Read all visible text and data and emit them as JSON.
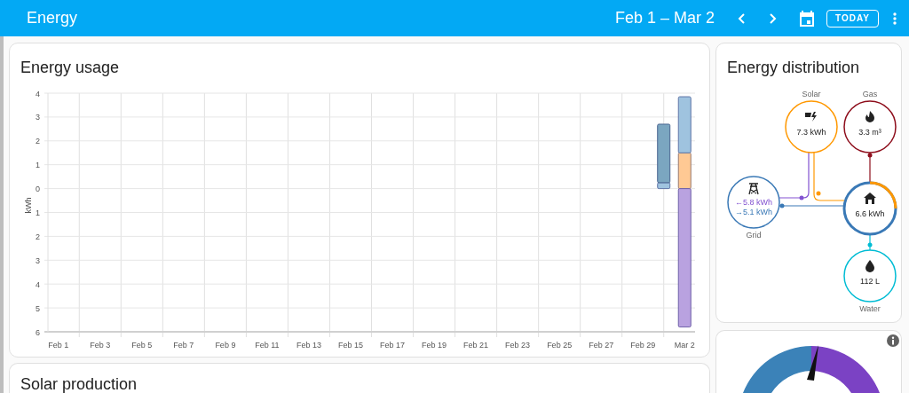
{
  "header": {
    "title": "Energy",
    "date_range": "Feb 1 – Mar 2",
    "today_button": "TODAY"
  },
  "energy_usage": {
    "title": "Energy usage",
    "chart_data": {
      "type": "bar",
      "stacked": true,
      "grid": true,
      "ylabel": "kWh",
      "categories": [
        "Feb 1",
        null,
        "Feb 3",
        null,
        "Feb 5",
        null,
        "Feb 7",
        null,
        "Feb 9",
        null,
        "Feb 11",
        null,
        "Feb 13",
        null,
        "Feb 15",
        null,
        "Feb 17",
        null,
        "Feb 19",
        null,
        "Feb 21",
        null,
        "Feb 23",
        null,
        "Feb 25",
        null,
        "Feb 27",
        null,
        "Feb 29",
        null,
        "Mar 2"
      ],
      "series": [
        {
          "color": "#9fc3df",
          "values": [
            null,
            null,
            null,
            null,
            null,
            null,
            null,
            null,
            null,
            null,
            null,
            null,
            null,
            null,
            null,
            null,
            null,
            null,
            null,
            null,
            null,
            null,
            null,
            null,
            null,
            null,
            null,
            null,
            null,
            0.25,
            null
          ]
        },
        {
          "color": "#7ba6c0",
          "values": [
            null,
            null,
            null,
            null,
            null,
            null,
            null,
            null,
            null,
            null,
            null,
            null,
            null,
            null,
            null,
            null,
            null,
            null,
            null,
            null,
            null,
            null,
            null,
            null,
            null,
            null,
            null,
            null,
            null,
            2.45,
            null
          ]
        },
        {
          "color": "#ffc994",
          "values": [
            null,
            null,
            null,
            null,
            null,
            null,
            null,
            null,
            null,
            null,
            null,
            null,
            null,
            null,
            null,
            null,
            null,
            null,
            null,
            null,
            null,
            null,
            null,
            null,
            null,
            null,
            null,
            null,
            null,
            null,
            1.5
          ]
        },
        {
          "color": "#9fc3df",
          "values": [
            null,
            null,
            null,
            null,
            null,
            null,
            null,
            null,
            null,
            null,
            null,
            null,
            null,
            null,
            null,
            null,
            null,
            null,
            null,
            null,
            null,
            null,
            null,
            null,
            null,
            null,
            null,
            null,
            null,
            null,
            2.35
          ]
        },
        {
          "color": "#b9a2e0",
          "values": [
            null,
            null,
            null,
            null,
            null,
            null,
            null,
            null,
            null,
            null,
            null,
            null,
            null,
            null,
            null,
            null,
            null,
            null,
            null,
            null,
            null,
            null,
            null,
            null,
            null,
            null,
            null,
            null,
            null,
            null,
            -5.8
          ]
        }
      ],
      "ylim": [
        -6,
        4
      ],
      "yticks": [
        4,
        3,
        2,
        1,
        0,
        {
          "value": -1,
          "label": "1"
        },
        {
          "value": -2,
          "label": "2"
        },
        {
          "value": -3,
          "label": "3"
        },
        {
          "value": -4,
          "label": "4"
        },
        {
          "value": -5,
          "label": "5"
        },
        {
          "value": -6,
          "label": "6"
        }
      ]
    }
  },
  "energy_distribution": {
    "title": "Energy distribution",
    "nodes": [
      {
        "kind": "solar",
        "label": "Solar",
        "values": [
          "7.3 kWh"
        ]
      },
      {
        "kind": "gas",
        "label": "Gas",
        "values": [
          "3.3 m³"
        ]
      },
      {
        "kind": "grid",
        "label": "Grid",
        "values": [
          "←5.8 kWh",
          "→5.1 kWh"
        ]
      },
      {
        "kind": "home",
        "values": [
          "6.6 kWh"
        ]
      },
      {
        "kind": "water",
        "label": "Water",
        "values": [
          "112 L"
        ]
      }
    ]
  },
  "solar_production": {
    "title": "Solar production"
  }
}
